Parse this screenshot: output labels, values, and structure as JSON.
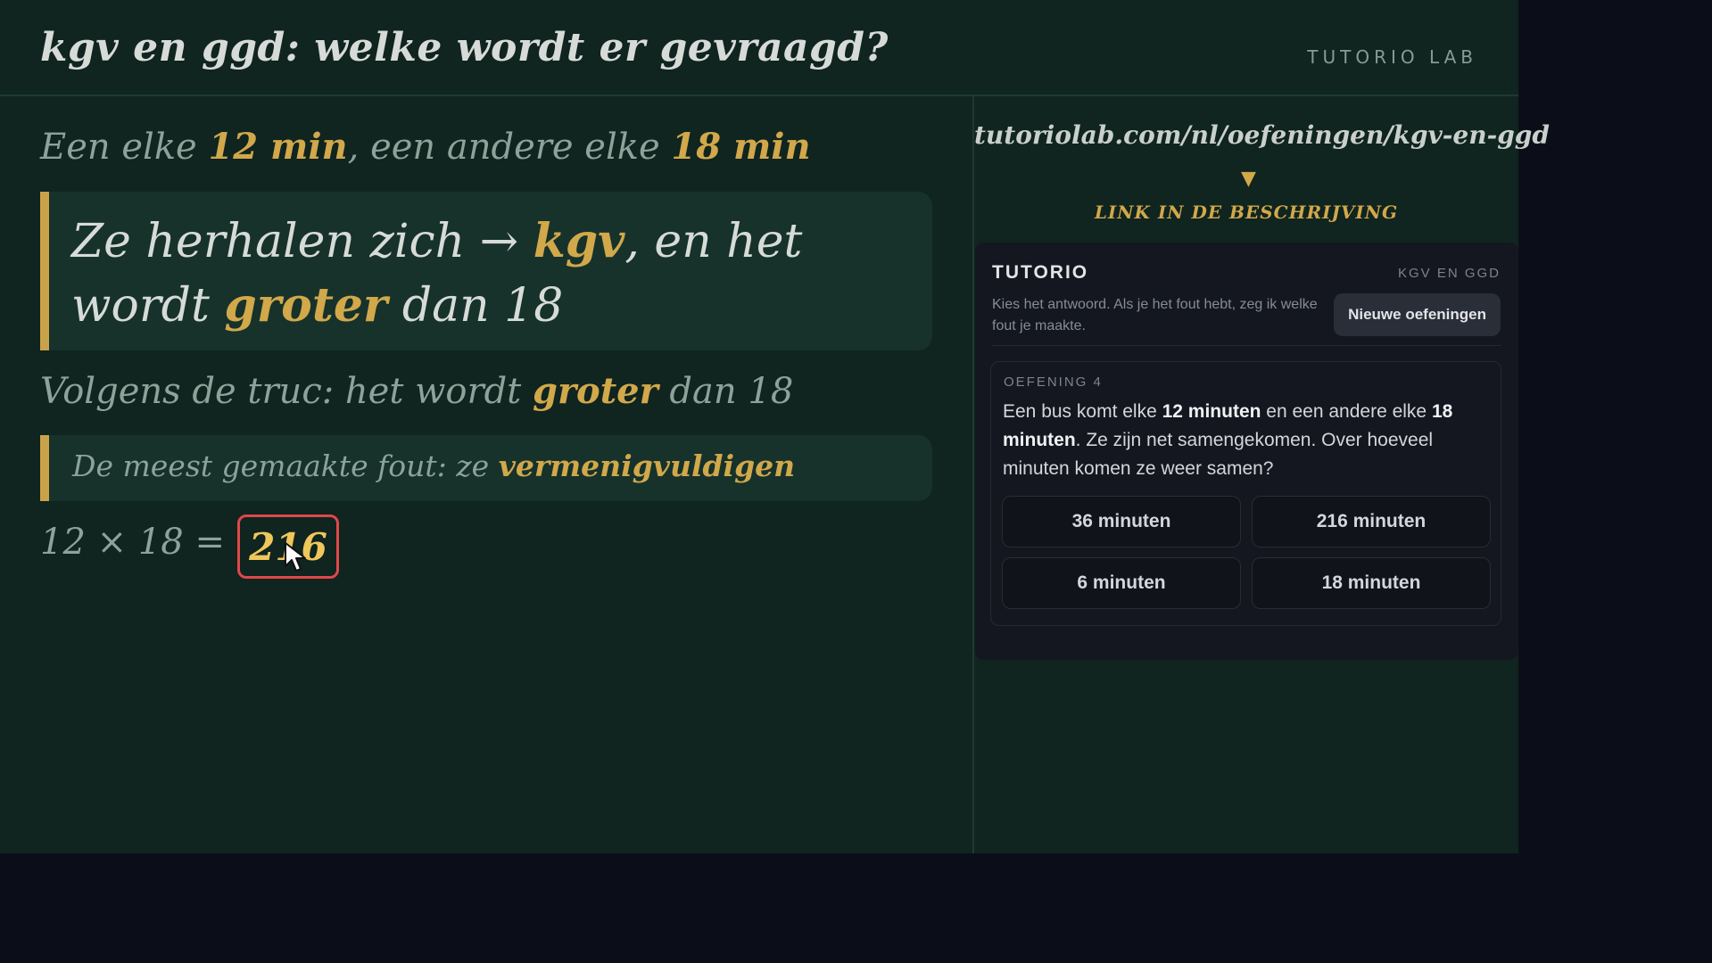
{
  "header": {
    "title": "kgv en ggd: welke wordt er gevraagd?",
    "brand": "TUTORIO LAB"
  },
  "board": {
    "line1": {
      "p1": "Een elke ",
      "h1": "12 min",
      "p2": ", een andere elke ",
      "h2": "18 min"
    },
    "box1": {
      "p1": "Ze herhalen zich  →  ",
      "h1": "kgv",
      "p2": ", en het wordt ",
      "h2": "groter",
      "p3": " dan 18"
    },
    "line3": {
      "p1": "Volgens de truc: het wordt ",
      "h1": "groter",
      "p2": " dan 18"
    },
    "box2": {
      "p1": "De meest gemaakte fout: ze ",
      "h1": "vermenigvuldigen"
    },
    "equation": {
      "expr": "12 × 18 =",
      "result": "216"
    }
  },
  "side": {
    "url": "tutoriolab.com/nl/oefeningen/kgv-en-ggd",
    "arrow": "▼",
    "link_label": "LINK IN DE BESCHRIJVING"
  },
  "widget": {
    "title": "TUTORIO",
    "topic": "KGV EN GGD",
    "description": "Kies het antwoord. Als je het fout hebt, zeg ik welke fout je maakte.",
    "new_button": "Nieuwe oefeningen",
    "exercise_label": "OEFENING 4",
    "question": {
      "p1": "Een bus komt elke ",
      "b1": "12 minuten",
      "p2": " en een andere elke ",
      "b2": "18 minuten",
      "p3": ". Ze zijn net samengekomen. Over hoeveel minuten komen ze weer samen?"
    },
    "options": [
      "36 minuten",
      "216 minuten",
      "6 minuten",
      "18 minuten"
    ]
  },
  "colors": {
    "board_bg": "#102420",
    "highlight": "#d1a84a",
    "error_border": "#e04848",
    "page_bg": "#0b0e19"
  }
}
